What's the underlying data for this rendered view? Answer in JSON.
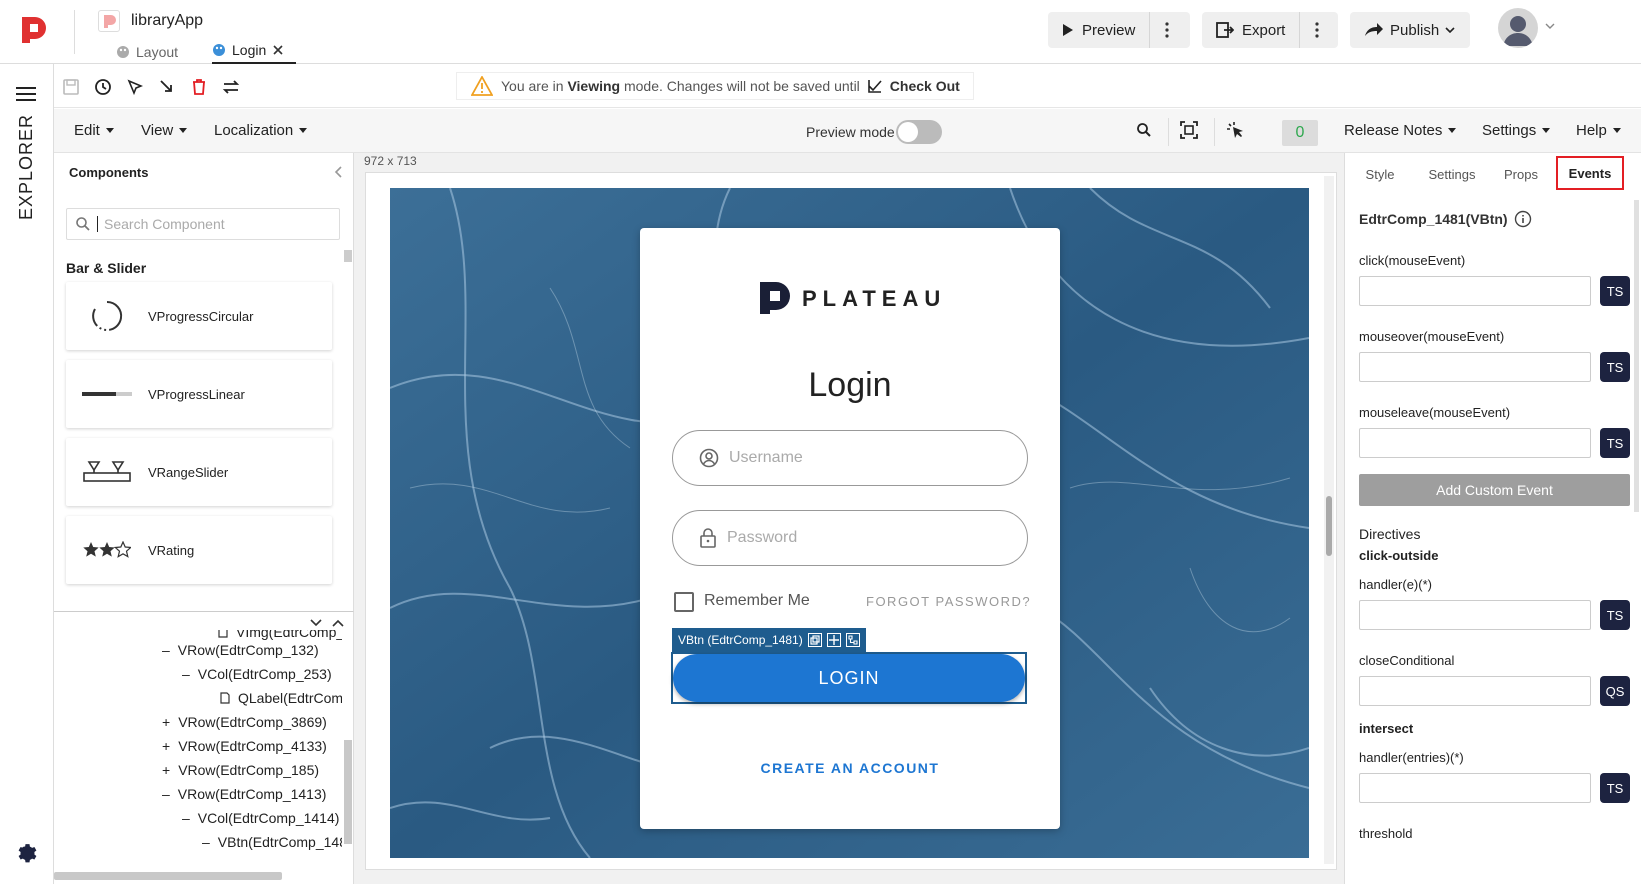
{
  "app": {
    "title": "libraryApp",
    "file_tabs": [
      {
        "label": "Layout"
      },
      {
        "label": "Login"
      }
    ]
  },
  "header": {
    "preview_label": "Preview",
    "export_label": "Export",
    "publish_label": "Publish"
  },
  "rail": {
    "explorer_label": "EXPLORER"
  },
  "banner": {
    "prefix": "You are in ",
    "mode": "Viewing",
    "suffix": " mode. Changes will not be saved until",
    "action": "Check Out"
  },
  "menu": {
    "edit": "Edit",
    "view": "View",
    "localization": "Localization",
    "preview_mode": "Preview mode",
    "count": "0",
    "release_notes": "Release Notes",
    "settings": "Settings",
    "help": "Help"
  },
  "components": {
    "title": "Components",
    "search_placeholder": "Search Component",
    "group_title": "Bar & Slider",
    "items": [
      {
        "name": "VProgressCircular",
        "icon": "progress-circular-icon"
      },
      {
        "name": "VProgressLinear",
        "icon": "progress-linear-icon"
      },
      {
        "name": "VRangeSlider",
        "icon": "range-slider-icon"
      },
      {
        "name": "VRating",
        "icon": "rating-icon"
      }
    ]
  },
  "tree": {
    "items": [
      {
        "toggle": "",
        "label": "VImg(EdtrComp_"
      },
      {
        "toggle": "–",
        "label": "VRow(EdtrComp_132)"
      },
      {
        "toggle": "–",
        "label": "VCol(EdtrComp_253)"
      },
      {
        "toggle": "",
        "label": "QLabel(EdtrComp"
      },
      {
        "toggle": "+",
        "label": "VRow(EdtrComp_3869)"
      },
      {
        "toggle": "+",
        "label": "VRow(EdtrComp_4133)"
      },
      {
        "toggle": "+",
        "label": "VRow(EdtrComp_185)"
      },
      {
        "toggle": "–",
        "label": "VRow(EdtrComp_1413)"
      },
      {
        "toggle": "–",
        "label": "VCol(EdtrComp_1414)"
      },
      {
        "toggle": "–",
        "label": "VBtn(EdtrComp_148"
      }
    ]
  },
  "canvas": {
    "size_label": "972 x 713",
    "brand": "PLATEAU",
    "title": "Login",
    "username_placeholder": "Username",
    "password_placeholder": "Password",
    "remember_label": "Remember Me",
    "forgot_label": "FORGOT PASSWORD?",
    "selection_tag": "VBtn (EdtrComp_1481)",
    "login_label": "LOGIN",
    "create_label": "CREATE AN ACCOUNT"
  },
  "right_panel": {
    "tabs": [
      {
        "label": "Style"
      },
      {
        "label": "Settings"
      },
      {
        "label": "Props"
      },
      {
        "label": "Events"
      }
    ],
    "component_id": "EdtrComp_1481(VBtn)",
    "events": [
      {
        "label": "click(mouseEvent)",
        "btn": "TS"
      },
      {
        "label": "mouseover(mouseEvent)",
        "btn": "TS"
      },
      {
        "label": "mouseleave(mouseEvent)",
        "btn": "TS"
      }
    ],
    "add_event_label": "Add Custom Event",
    "directives_title": "Directives",
    "click_outside_title": "click-outside",
    "handler_e_label": "handler(e)(*)",
    "handler_e_btn": "TS",
    "close_conditional_label": "closeConditional",
    "close_conditional_btn": "QS",
    "intersect_title": "intersect",
    "handler_entries_label": "handler(entries)(*)",
    "handler_entries_btn": "TS",
    "threshold_label": "threshold"
  },
  "colors": {
    "primary": "#1d76d2",
    "selection": "#1e5c8e",
    "active_tab_border": "#e31e24",
    "brand_red": "#e03131",
    "ts_button": "#1d2340",
    "count_green": "#2fa84f"
  }
}
